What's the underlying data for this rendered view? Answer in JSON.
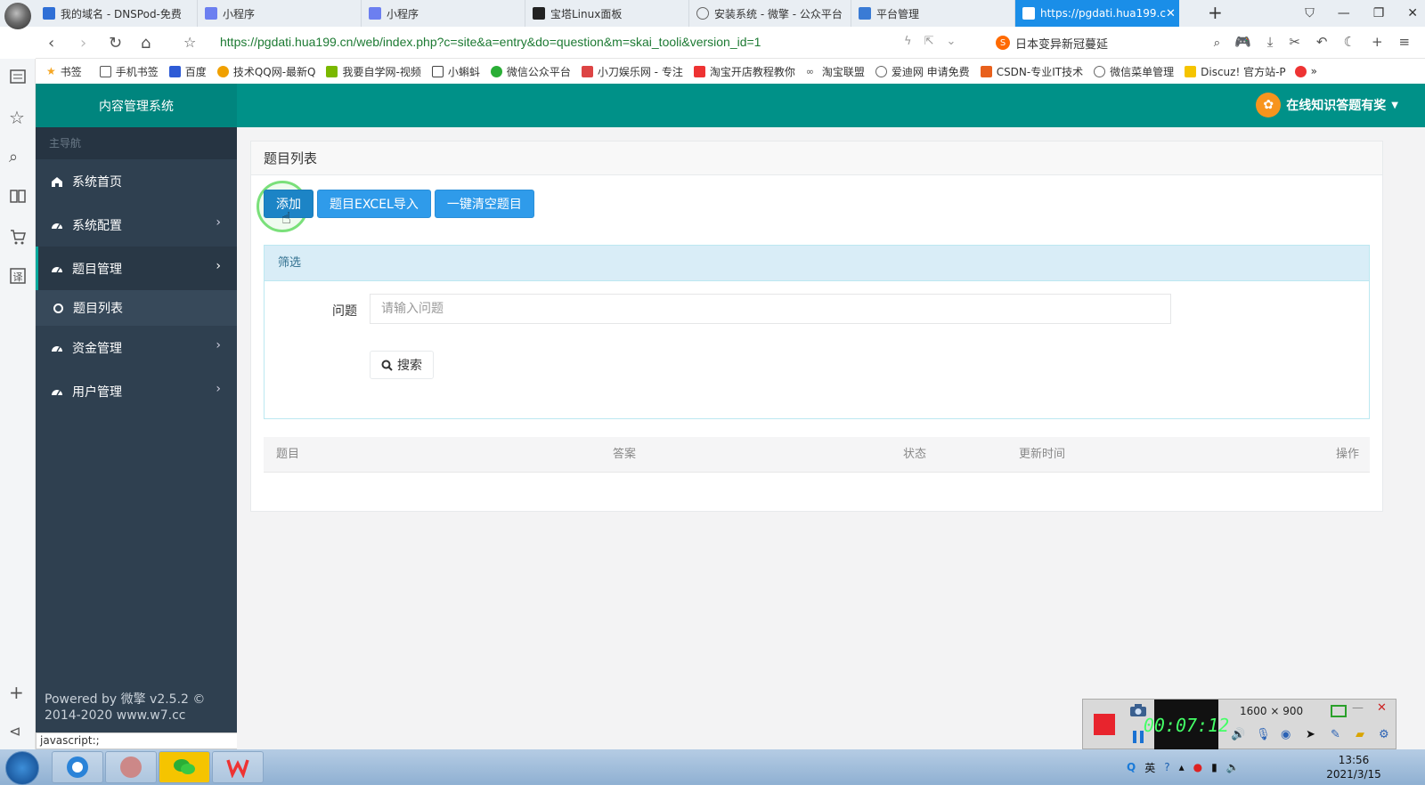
{
  "browser": {
    "tabs": [
      {
        "title": "我的域名 - DNSPod-免费"
      },
      {
        "title": "小程序"
      },
      {
        "title": "小程序"
      },
      {
        "title": "宝塔Linux面板"
      },
      {
        "title": "安装系统 - 微擎 - 公众平台"
      },
      {
        "title": "平台管理"
      },
      {
        "title": "https://pgdati.hua199.c"
      }
    ],
    "url": "https://pgdati.hua199.cn/web/index.php?c=site&a=entry&do=question&m=skai_tooli&version_id=1",
    "search_text": "日本变异新冠蔓延",
    "bookmarks": [
      "书签",
      "手机书签",
      "百度",
      "技术QQ网-最新Q",
      "我要自学网-视频",
      "小蝌蚪",
      "微信公众平台",
      "小刀娱乐网 - 专注",
      "淘宝开店教程教你",
      "淘宝联盟",
      "爱迪网 申请免费",
      "CSDN-专业IT技术",
      "微信菜单管理",
      "Discuz! 官方站-P"
    ],
    "status_text": "javascript:;"
  },
  "app": {
    "brand": "内容管理系统",
    "user_name": "在线知识答题有奖",
    "sidebar": {
      "header": "主导航",
      "items": [
        {
          "label": "系统首页"
        },
        {
          "label": "系统配置"
        },
        {
          "label": "题目管理"
        },
        {
          "label": "题目列表"
        },
        {
          "label": "资金管理"
        },
        {
          "label": "用户管理"
        }
      ],
      "footer_line1": "Powered by 微擎 v2.5.2 ©",
      "footer_line2": "2014-2020 www.w7.cc"
    },
    "main": {
      "panel_title": "题目列表",
      "buttons": {
        "add": "添加",
        "import": "题目EXCEL导入",
        "clear": "一键清空题目"
      },
      "filter": {
        "heading": "筛选",
        "question_label": "问题",
        "question_placeholder": "请输入问题",
        "search_button": "搜索"
      },
      "table_headers": [
        "题目",
        "答案",
        "状态",
        "更新时间",
        "操作"
      ]
    }
  },
  "recorder": {
    "time": "00:07:12",
    "resolution": "1600 × 900"
  },
  "taskbar": {
    "ime": "英",
    "time": "13:56",
    "date": "2021/3/15"
  },
  "colors": {
    "header_teal": "#009188",
    "sidebar_dark": "#2f4050",
    "primary_blue": "#1c84c6",
    "tab_active": "#1a8ee8"
  }
}
